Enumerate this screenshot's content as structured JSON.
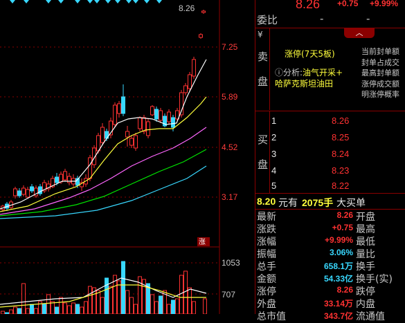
{
  "chart": {
    "price_axis": [
      "8.26",
      "7.25",
      "5.89",
      "4.52",
      "3.17"
    ],
    "volume_axis": [
      "1053",
      "707"
    ],
    "last_price_tag": "8.26",
    "limit_tag": "涨",
    "colors": {
      "up": "#ff3232",
      "down": "#38d8ff",
      "ma5": "#ffffff",
      "ma10": "#ffff3c",
      "ma20": "#ff66ff",
      "ma30": "#00e600",
      "ma60": "#38d8ff"
    }
  },
  "quote": {
    "price": "8.26",
    "change": "+0.75",
    "change_pct": "+9.99%"
  },
  "weibi": {
    "label": "委比",
    "value1": "-",
    "value2": "-"
  },
  "sell_side_chars": [
    "¥",
    "卖",
    "盘"
  ],
  "limit_panel": {
    "title": "涨停(7天5板)",
    "analysis_label": "ⓘ分析:",
    "analysis_value": "油气开采+",
    "concept": "哈萨克斯坦油田",
    "seal_items": [
      "当前封单额",
      "封单占成交",
      "最高封单额",
      "涨停成交额",
      "明涨停概率"
    ]
  },
  "buy_side_chars": [
    "买",
    "盘"
  ],
  "bids": [
    {
      "level": "1",
      "price": "8.26"
    },
    {
      "level": "2",
      "price": "8.25"
    },
    {
      "level": "3",
      "price": "8.24"
    },
    {
      "level": "4",
      "price": "8.23"
    },
    {
      "level": "5",
      "price": "8.22"
    }
  ],
  "big_order": {
    "price": "8.20",
    "unit": "元有",
    "qty": "2075手",
    "text": "大买单"
  },
  "stats": [
    {
      "key": "最新",
      "value": "8.26",
      "color": "red",
      "key2": "开盘"
    },
    {
      "key": "涨跌",
      "value": "+0.75",
      "color": "red",
      "key2": "最高"
    },
    {
      "key": "涨幅",
      "value": "+9.99%",
      "color": "red",
      "key2": "最低"
    },
    {
      "key": "振幅",
      "value": "3.06%",
      "color": "cyan",
      "key2": "量比"
    },
    {
      "key": "总手",
      "value": "658.1万",
      "color": "cyan",
      "key2": "换手"
    },
    {
      "key": "金额",
      "value": "54.33亿",
      "color": "cyan",
      "key2": "换手(实)"
    },
    {
      "key": "涨停",
      "value": "8.26",
      "color": "red",
      "key2": "跌停"
    },
    {
      "key": "外盘",
      "value": "33.14万",
      "color": "red",
      "key2": "内盘"
    },
    {
      "key": "总市值",
      "value": "343.7亿",
      "color": "red",
      "key2": "流通值"
    }
  ]
}
